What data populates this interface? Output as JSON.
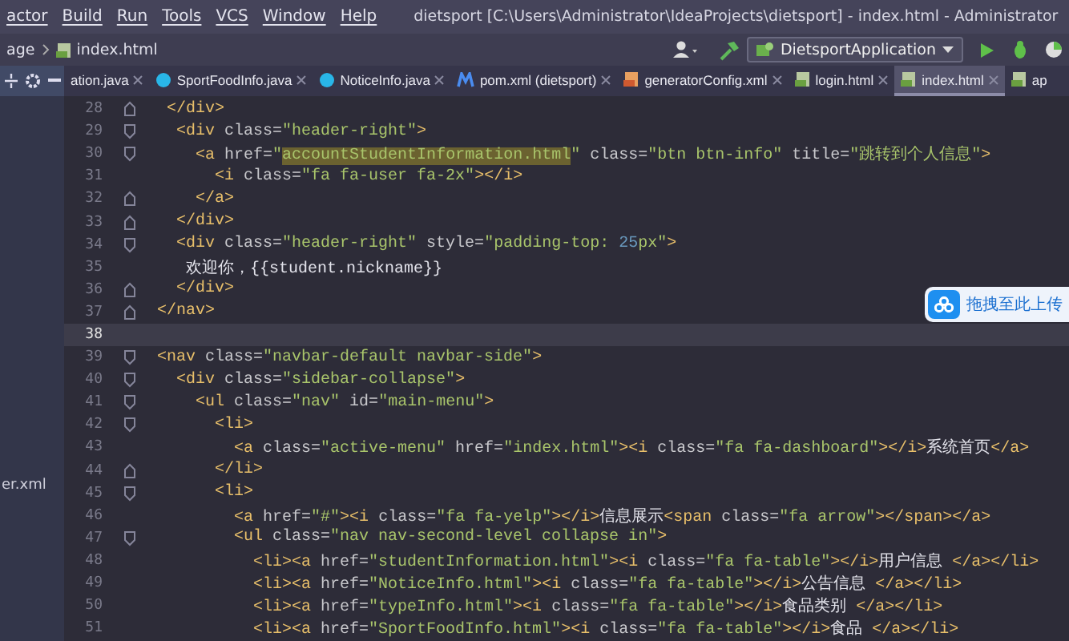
{
  "menu_bar": {
    "items": [
      "actor",
      "Build",
      "Run",
      "Tools",
      "VCS",
      "Window",
      "Help"
    ],
    "title": "dietsport [C:\\Users\\Administrator\\IdeaProjects\\dietsport] - index.html - Administrator"
  },
  "nav_bar": {
    "breadcrumbs": [
      {
        "label": "age",
        "kind": "folder"
      },
      {
        "label": "index.html",
        "kind": "html"
      }
    ],
    "run_config": "DietsportApplication"
  },
  "tabs": [
    {
      "label": "ation.java",
      "kind": "none",
      "selected": false
    },
    {
      "label": "SportFoodInfo.java",
      "kind": "java",
      "selected": false
    },
    {
      "label": "NoticeInfo.java",
      "kind": "java",
      "selected": false
    },
    {
      "label": "pom.xml (dietsport)",
      "kind": "maven",
      "selected": false
    },
    {
      "label": "generatorConfig.xml",
      "kind": "xml",
      "selected": false
    },
    {
      "label": "login.html",
      "kind": "html",
      "selected": false
    },
    {
      "label": "index.html",
      "kind": "html",
      "selected": true
    },
    {
      "label": "ap",
      "kind": "html",
      "selected": false
    }
  ],
  "project_panel": {
    "items": [
      "er.xml"
    ]
  },
  "editor": {
    "lines": [
      {
        "number": "28",
        "current": false,
        "fold_start": false,
        "fold_end": true,
        "tokens": [
          {
            "kind": "tag",
            "text": " </div>"
          }
        ]
      },
      {
        "number": "29",
        "current": false,
        "fold_start": true,
        "fold_end": false,
        "tokens": [
          {
            "kind": "tag",
            "text": "  <div"
          },
          {
            "kind": "attr",
            "text": " class="
          },
          {
            "kind": "str",
            "text": "\"header-right\""
          },
          {
            "kind": "tag",
            "text": ">"
          }
        ]
      },
      {
        "number": "30",
        "current": false,
        "fold_start": true,
        "fold_end": false,
        "tokens": [
          {
            "kind": "tag",
            "text": "    <a"
          },
          {
            "kind": "attr",
            "text": " href="
          },
          {
            "kind": "str",
            "text": "\""
          },
          {
            "kind": "match",
            "text": "accountStudentInformation.html"
          },
          {
            "kind": "str",
            "text": "\""
          },
          {
            "kind": "attr",
            "text": " class="
          },
          {
            "kind": "str",
            "text": "\"btn btn-info\""
          },
          {
            "kind": "attr",
            "text": " title="
          },
          {
            "kind": "str",
            "text": "\"跳转到个人信息\""
          },
          {
            "kind": "tag",
            "text": ">"
          }
        ]
      },
      {
        "number": "31",
        "current": false,
        "fold_start": false,
        "fold_end": false,
        "tokens": [
          {
            "kind": "tag",
            "text": "      <i"
          },
          {
            "kind": "attr",
            "text": " class="
          },
          {
            "kind": "str",
            "text": "\"fa fa-user fa-2x\""
          },
          {
            "kind": "tag",
            "text": "></i>"
          }
        ]
      },
      {
        "number": "32",
        "current": false,
        "fold_start": false,
        "fold_end": true,
        "tokens": [
          {
            "kind": "tag",
            "text": "    </a>"
          }
        ]
      },
      {
        "number": "33",
        "current": false,
        "fold_start": false,
        "fold_end": true,
        "tokens": [
          {
            "kind": "tag",
            "text": "  </div>"
          }
        ]
      },
      {
        "number": "34",
        "current": false,
        "fold_start": true,
        "fold_end": false,
        "tokens": [
          {
            "kind": "tag",
            "text": "  <div"
          },
          {
            "kind": "attr",
            "text": " class="
          },
          {
            "kind": "str",
            "text": "\"header-right\""
          },
          {
            "kind": "attr",
            "text": " style="
          },
          {
            "kind": "str",
            "text": "\"padding-top: "
          },
          {
            "kind": "num",
            "text": "25"
          },
          {
            "kind": "str",
            "text": "px\""
          },
          {
            "kind": "tag",
            "text": ">"
          }
        ]
      },
      {
        "number": "35",
        "current": false,
        "fold_start": false,
        "fold_end": false,
        "tokens": [
          {
            "kind": "text",
            "text": "   欢迎你，{{student.nickname}}"
          }
        ]
      },
      {
        "number": "36",
        "current": false,
        "fold_start": false,
        "fold_end": true,
        "tokens": [
          {
            "kind": "tag",
            "text": "  </div>"
          }
        ]
      },
      {
        "number": "37",
        "current": false,
        "fold_start": false,
        "fold_end": true,
        "tokens": [
          {
            "kind": "tag",
            "text": "</nav>"
          }
        ]
      },
      {
        "number": "38",
        "current": true,
        "fold_start": false,
        "fold_end": false
      },
      {
        "number": "39",
        "current": false,
        "fold_start": true,
        "fold_end": false,
        "tokens": [
          {
            "kind": "tag",
            "text": "<nav"
          },
          {
            "kind": "attr",
            "text": " class="
          },
          {
            "kind": "str",
            "text": "\"navbar-default navbar-side\""
          },
          {
            "kind": "tag",
            "text": ">"
          }
        ]
      },
      {
        "number": "40",
        "current": false,
        "fold_start": true,
        "fold_end": false,
        "tokens": [
          {
            "kind": "tag",
            "text": "  <div"
          },
          {
            "kind": "attr",
            "text": " class="
          },
          {
            "kind": "str",
            "text": "\"sidebar-collapse\""
          },
          {
            "kind": "tag",
            "text": ">"
          }
        ]
      },
      {
        "number": "41",
        "current": false,
        "fold_start": true,
        "fold_end": false,
        "tokens": [
          {
            "kind": "tag",
            "text": "    <ul"
          },
          {
            "kind": "attr",
            "text": " class="
          },
          {
            "kind": "str",
            "text": "\"nav\""
          },
          {
            "kind": "attr",
            "text": " id="
          },
          {
            "kind": "str",
            "text": "\"main-menu\""
          },
          {
            "kind": "tag",
            "text": ">"
          }
        ]
      },
      {
        "number": "42",
        "current": false,
        "fold_start": true,
        "fold_end": false,
        "tokens": [
          {
            "kind": "tag",
            "text": "      <li>"
          }
        ]
      },
      {
        "number": "43",
        "current": false,
        "fold_start": false,
        "fold_end": false,
        "tokens": [
          {
            "kind": "tag",
            "text": "        <a"
          },
          {
            "kind": "attr",
            "text": " class="
          },
          {
            "kind": "str",
            "text": "\"active-menu\""
          },
          {
            "kind": "attr",
            "text": " href="
          },
          {
            "kind": "str",
            "text": "\"index.html\""
          },
          {
            "kind": "tag",
            "text": "><i"
          },
          {
            "kind": "attr",
            "text": " class="
          },
          {
            "kind": "str",
            "text": "\"fa fa-dashboard\""
          },
          {
            "kind": "tag",
            "text": "></i>"
          },
          {
            "kind": "text",
            "text": "系统首页"
          },
          {
            "kind": "tag",
            "text": "</a>"
          }
        ]
      },
      {
        "number": "44",
        "current": false,
        "fold_start": false,
        "fold_end": true,
        "tokens": [
          {
            "kind": "tag",
            "text": "      </li>"
          }
        ]
      },
      {
        "number": "45",
        "current": false,
        "fold_start": true,
        "fold_end": false,
        "tokens": [
          {
            "kind": "tag",
            "text": "      <li>"
          }
        ]
      },
      {
        "number": "46",
        "current": false,
        "fold_start": false,
        "fold_end": false,
        "tokens": [
          {
            "kind": "tag",
            "text": "        <a"
          },
          {
            "kind": "attr",
            "text": " href="
          },
          {
            "kind": "str",
            "text": "\"#\""
          },
          {
            "kind": "tag",
            "text": "><i"
          },
          {
            "kind": "attr",
            "text": " class="
          },
          {
            "kind": "str",
            "text": "\"fa fa-yelp\""
          },
          {
            "kind": "tag",
            "text": "></i>"
          },
          {
            "kind": "text",
            "text": "信息展示"
          },
          {
            "kind": "tag",
            "text": "<span"
          },
          {
            "kind": "attr",
            "text": " class="
          },
          {
            "kind": "str",
            "text": "\"fa arrow\""
          },
          {
            "kind": "tag",
            "text": "></span></a>"
          }
        ]
      },
      {
        "number": "47",
        "current": false,
        "fold_start": true,
        "fold_end": false,
        "tokens": [
          {
            "kind": "tag",
            "text": "        <ul"
          },
          {
            "kind": "attr",
            "text": " class="
          },
          {
            "kind": "str",
            "text": "\"nav nav-second-level collapse in\""
          },
          {
            "kind": "tag",
            "text": ">"
          }
        ]
      },
      {
        "number": "48",
        "current": false,
        "fold_start": false,
        "fold_end": false,
        "tokens": [
          {
            "kind": "tag",
            "text": "          <li><a"
          },
          {
            "kind": "attr",
            "text": " href="
          },
          {
            "kind": "str",
            "text": "\"studentInformation.html\""
          },
          {
            "kind": "tag",
            "text": "><i"
          },
          {
            "kind": "attr",
            "text": " class="
          },
          {
            "kind": "str",
            "text": "\"fa fa-table\""
          },
          {
            "kind": "tag",
            "text": "></i>"
          },
          {
            "kind": "text",
            "text": "用户信息 "
          },
          {
            "kind": "tag",
            "text": "</a></li>"
          }
        ]
      },
      {
        "number": "49",
        "current": false,
        "fold_start": false,
        "fold_end": false,
        "tokens": [
          {
            "kind": "tag",
            "text": "          <li><a"
          },
          {
            "kind": "attr",
            "text": " href="
          },
          {
            "kind": "str",
            "text": "\"NoticeInfo.html\""
          },
          {
            "kind": "tag",
            "text": "><i"
          },
          {
            "kind": "attr",
            "text": " class="
          },
          {
            "kind": "str",
            "text": "\"fa fa-table\""
          },
          {
            "kind": "tag",
            "text": "></i>"
          },
          {
            "kind": "text",
            "text": "公告信息 "
          },
          {
            "kind": "tag",
            "text": "</a></li>"
          }
        ]
      },
      {
        "number": "50",
        "current": false,
        "fold_start": false,
        "fold_end": false,
        "tokens": [
          {
            "kind": "tag",
            "text": "          <li><a"
          },
          {
            "kind": "attr",
            "text": " href="
          },
          {
            "kind": "str",
            "text": "\"typeInfo.html\""
          },
          {
            "kind": "tag",
            "text": "><i"
          },
          {
            "kind": "attr",
            "text": " class="
          },
          {
            "kind": "str",
            "text": "\"fa fa-table\""
          },
          {
            "kind": "tag",
            "text": "></i>"
          },
          {
            "kind": "text",
            "text": "食品类别 "
          },
          {
            "kind": "tag",
            "text": "</a></li>"
          }
        ]
      },
      {
        "number": "51",
        "current": false,
        "fold_start": false,
        "fold_end": false,
        "tokens": [
          {
            "kind": "tag",
            "text": "          <li><a"
          },
          {
            "kind": "attr",
            "text": " href="
          },
          {
            "kind": "str",
            "text": "\"SportFoodInfo.html\""
          },
          {
            "kind": "tag",
            "text": "><i"
          },
          {
            "kind": "attr",
            "text": " class="
          },
          {
            "kind": "str",
            "text": "\"fa fa-table\""
          },
          {
            "kind": "tag",
            "text": "></i>"
          },
          {
            "kind": "text",
            "text": "食品 "
          },
          {
            "kind": "tag",
            "text": "</a></li>"
          }
        ]
      }
    ]
  },
  "upload_popup": {
    "label": "拖拽至此上传"
  }
}
